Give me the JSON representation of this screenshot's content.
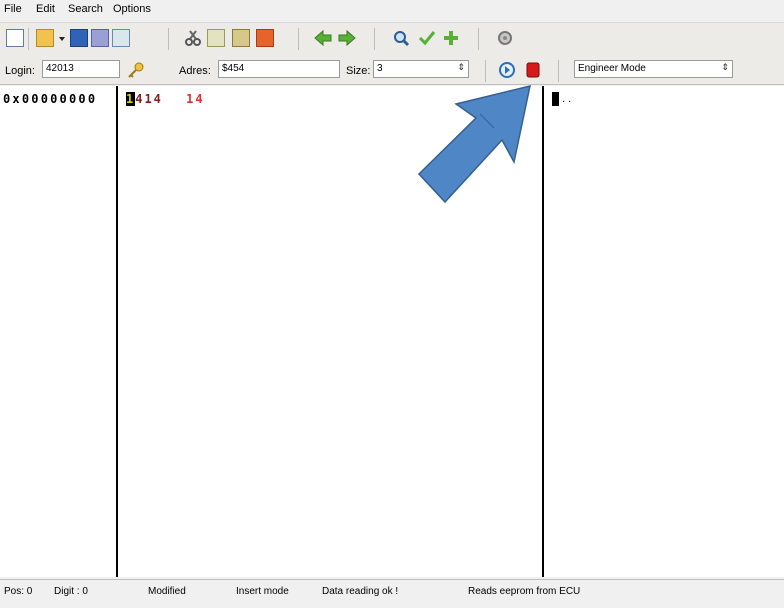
{
  "menu": [
    "File",
    "Edit",
    "Search",
    "Options"
  ],
  "address_bar": {
    "login_label": "Login:",
    "login_value": "42013",
    "adres_label": "Adres:",
    "adres_value": "$454",
    "size_label": "Size:",
    "size_value": "3",
    "mode_value": "Engineer Mode"
  },
  "editor": {
    "address": "0x00000000",
    "hex_cursor": "1",
    "hex_rest": "414",
    "hex_tail": "14",
    "annotation": "6",
    "ascii_dots": ". ."
  },
  "status": [
    "Pos: 0",
    "Digit : 0",
    "Modified",
    "Insert mode",
    "Data reading ok !",
    "Reads eeprom from ECU"
  ],
  "colors": {
    "hex_dark": "#8b1a1a",
    "hex_red": "#e03030",
    "arrow": "#4f86c6",
    "arrow_stroke": "#355f92"
  }
}
